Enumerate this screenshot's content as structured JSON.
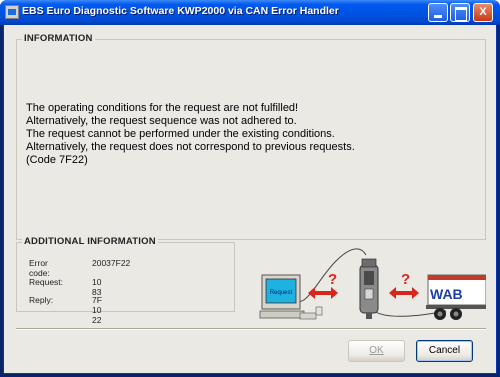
{
  "window": {
    "title": "EBS Euro Diagnostic Software  KWP2000 via CAN Error Handler"
  },
  "titlebar_buttons": {
    "minimize_icon": "minimize-icon",
    "maximize_icon": "maximize-icon",
    "close_glyph": "X"
  },
  "information": {
    "label": "INFORMATION",
    "lines": [
      "The operating conditions for the request are not fulfilled!",
      "Alternatively, the request sequence was not adhered to.",
      "The request cannot be performed under the existing conditions.",
      "Alternatively, the request does not correspond to previous requests.",
      "(Code 7F22)"
    ]
  },
  "additional_information": {
    "label": "ADDITIONAL INFORMATION",
    "error_code_label": "Error code:",
    "error_code_value": "20037F22",
    "request_label": "Request:",
    "request_value": "10 83",
    "reply_label": "Reply:",
    "reply_value": "7F 10 22"
  },
  "illustration": {
    "screen_text": "Request",
    "question_mark": "?",
    "truck_text": "WAB"
  },
  "buttons": {
    "ok": "OK",
    "cancel": "Cancel"
  },
  "colors": {
    "titlebar": "#0054e3",
    "dialog_background": "#ebe9e4",
    "arrow_red": "#d9261c",
    "truck_blue": "#1d3fa3"
  }
}
